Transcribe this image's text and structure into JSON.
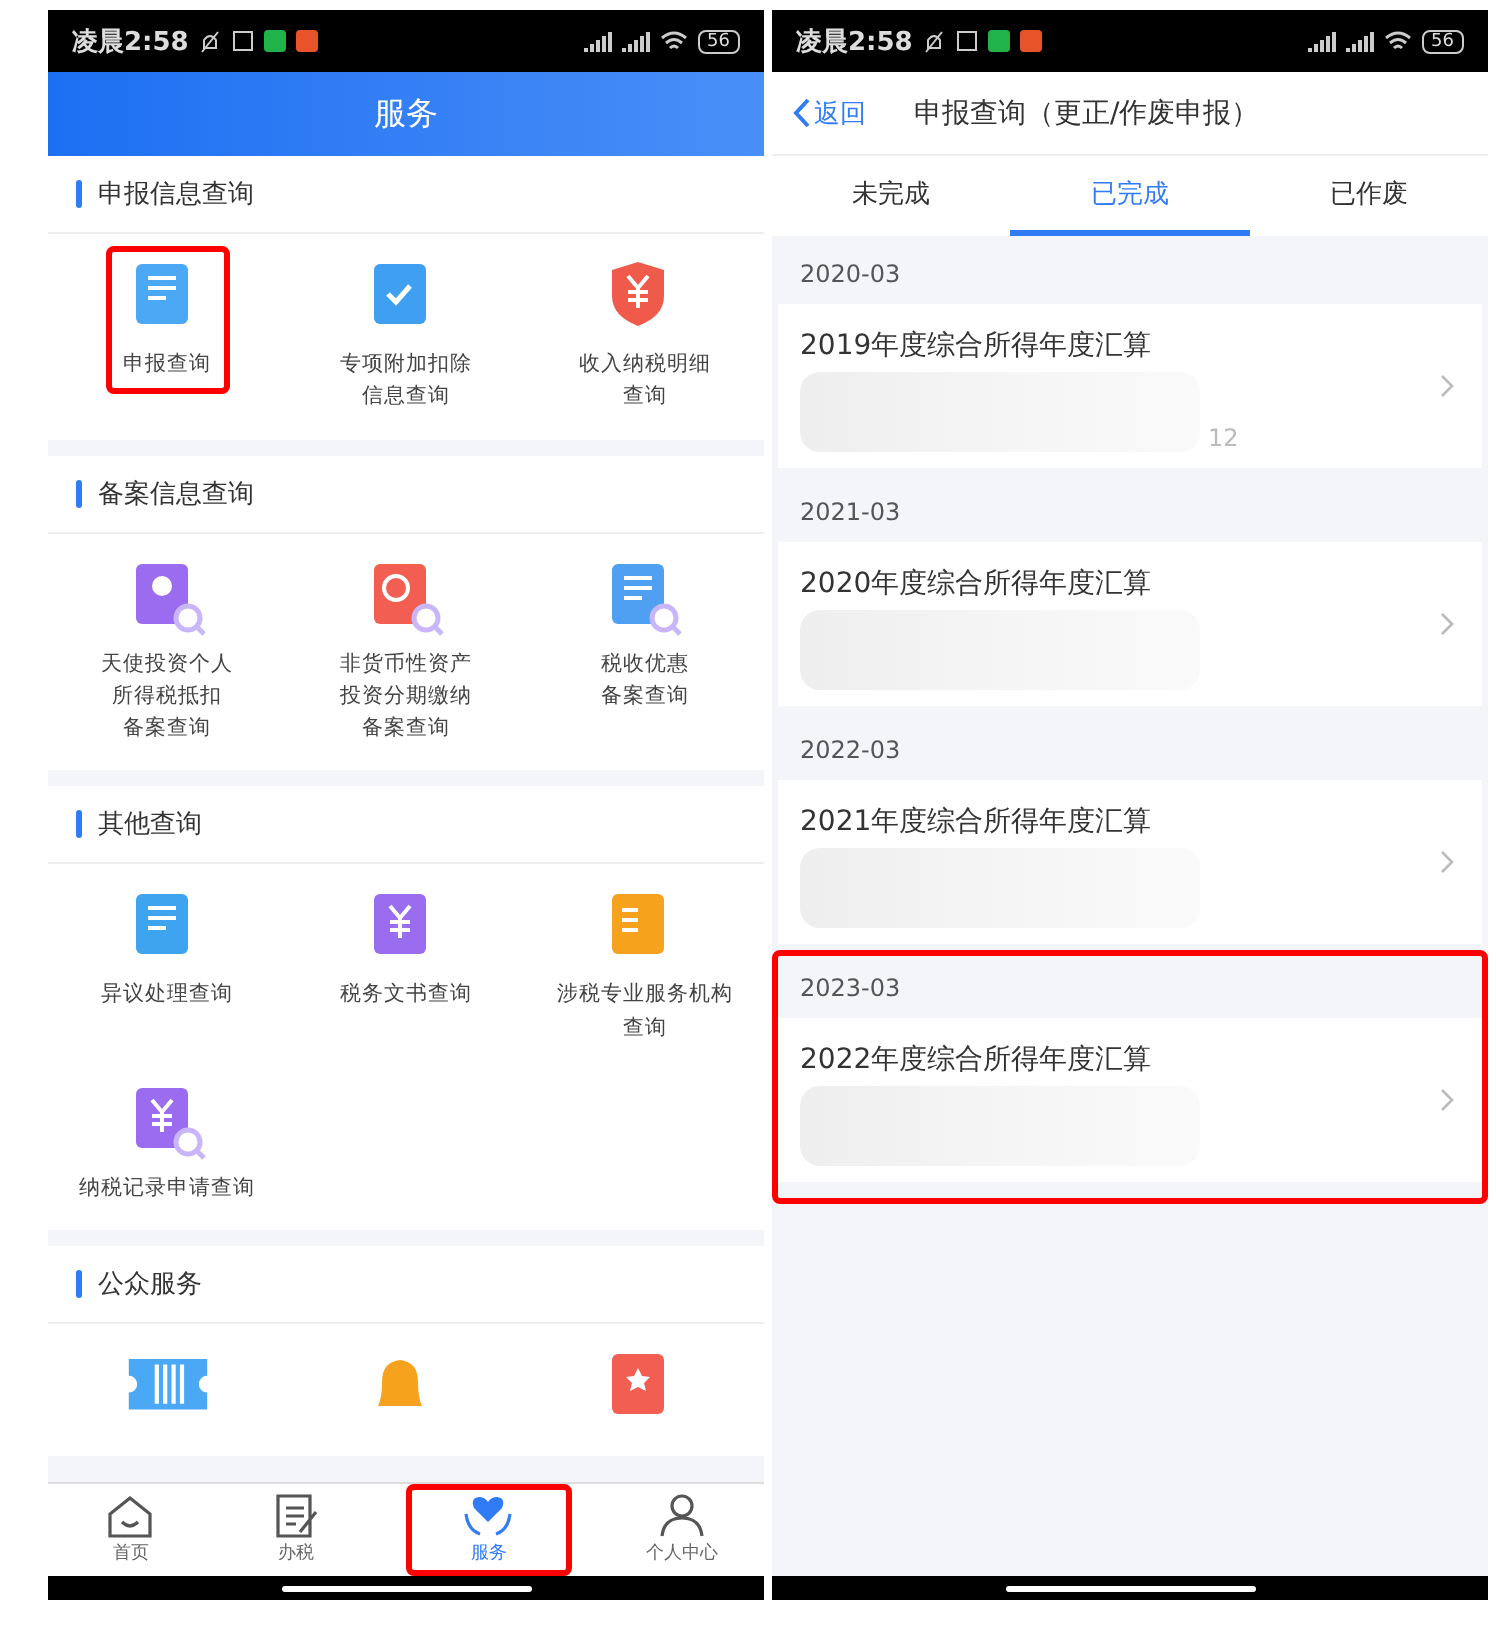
{
  "left": {
    "status": {
      "time": "凌晨2:58",
      "battery": "56"
    },
    "title": "服务",
    "sections": [
      {
        "title": "申报信息查询",
        "items": [
          {
            "kind": "doc",
            "lines": [
              "申报查询"
            ],
            "highlighted": true
          },
          {
            "kind": "clipboard",
            "lines": [
              "专项附加扣除",
              "信息查询"
            ],
            "highlighted": false
          },
          {
            "kind": "shield",
            "lines": [
              "收入纳税明细",
              "查询"
            ],
            "highlighted": false
          }
        ]
      },
      {
        "title": "备案信息查询",
        "items": [
          {
            "kind": "person",
            "lines": [
              "天使投资个人",
              "所得税抵扣",
              "备案查询"
            ],
            "highlighted": false
          },
          {
            "kind": "chart",
            "lines": [
              "非货币性资产",
              "投资分期缴纳",
              "备案查询"
            ],
            "highlighted": false
          },
          {
            "kind": "list",
            "lines": [
              "税收优惠",
              "备案查询"
            ],
            "highlighted": false
          }
        ]
      },
      {
        "title": "其他查询",
        "items": [
          {
            "kind": "chat",
            "lines": [
              "异议处理查询"
            ],
            "highlighted": false
          },
          {
            "kind": "book",
            "lines": [
              "税务文书查询"
            ],
            "highlighted": false
          },
          {
            "kind": "building",
            "lines": [
              "涉税专业服务机构",
              "查询"
            ],
            "highlighted": false
          },
          {
            "kind": "yen",
            "lines": [
              "纳税记录申请查询"
            ],
            "highlighted": false
          }
        ]
      },
      {
        "title": "公众服务",
        "items": [
          {
            "kind": "ticket"
          },
          {
            "kind": "bell"
          },
          {
            "kind": "star"
          }
        ]
      }
    ],
    "tabbar": [
      {
        "kind": "home",
        "label": "首页",
        "selected": false,
        "highlighted": false
      },
      {
        "kind": "edit",
        "label": "办税",
        "selected": false,
        "highlighted": false
      },
      {
        "kind": "heart",
        "label": "服务",
        "selected": true,
        "highlighted": true
      },
      {
        "kind": "person",
        "label": "个人中心",
        "selected": false,
        "highlighted": false
      }
    ]
  },
  "right": {
    "status": {
      "time": "凌晨2:58",
      "battery": "56"
    },
    "back": "返回",
    "title": "申报查询（更正/作废申报）",
    "tabs": [
      {
        "label": "未完成",
        "selected": false
      },
      {
        "label": "已完成",
        "selected": true
      },
      {
        "label": "已作废",
        "selected": false
      }
    ],
    "groups": [
      {
        "date": "2020-03",
        "title": "2019年度综合所得年度汇算",
        "fragment": "12",
        "highlighted": false
      },
      {
        "date": "2021-03",
        "title": "2020年度综合所得年度汇算",
        "highlighted": false
      },
      {
        "date": "2022-03",
        "title": "2021年度综合所得年度汇算",
        "highlighted": false
      },
      {
        "date": "2023-03",
        "title": "2022年度综合所得年度汇算",
        "highlighted": true
      }
    ]
  }
}
